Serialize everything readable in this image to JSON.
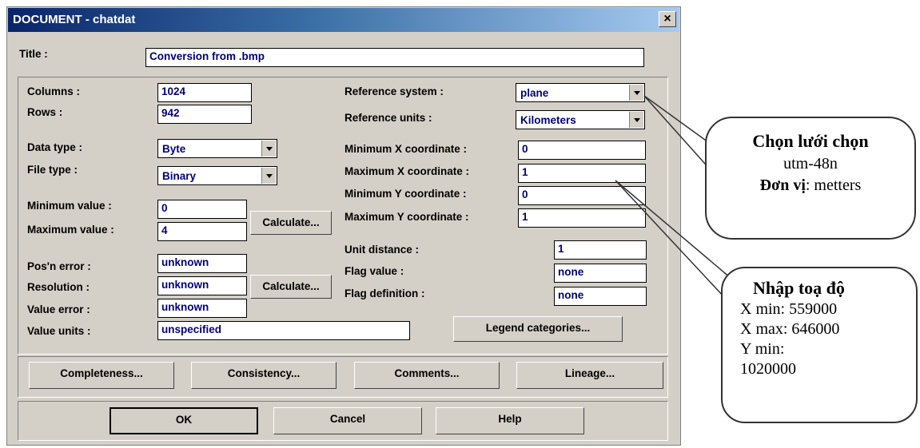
{
  "window": {
    "title": "DOCUMENT - chatdat",
    "close_glyph": "×"
  },
  "title_label": "Title :",
  "title_value": "Conversion from .bmp",
  "left": {
    "columns_label": "Columns :",
    "columns_value": "1024",
    "rows_label": "Rows :",
    "rows_value": "942",
    "data_type_label": "Data type :",
    "data_type_value": "Byte",
    "file_type_label": "File type :",
    "file_type_value": "Binary",
    "min_value_label": "Minimum value :",
    "min_value": "0",
    "max_value_label": "Maximum value :",
    "max_value": "4",
    "calculate1": "Calculate...",
    "pos_error_label": "Pos'n error :",
    "pos_error_value": "unknown",
    "resolution_label": "Resolution :",
    "resolution_value": "unknown",
    "calculate2": "Calculate...",
    "value_error_label": "Value error :",
    "value_error_value": "unknown",
    "value_units_label": "Value units :",
    "value_units_value": "unspecified"
  },
  "right": {
    "ref_system_label": "Reference system :",
    "ref_system_value": "plane",
    "ref_units_label": "Reference units :",
    "ref_units_value": "Kilometers",
    "min_x_label": "Minimum X coordinate :",
    "min_x_value": "0",
    "max_x_label": "Maximum X coordinate :",
    "max_x_value": "1",
    "min_y_label": "Minimum Y coordinate :",
    "min_y_value": "0",
    "max_y_label": "Maximum Y coordinate :",
    "max_y_value": "1",
    "unit_distance_label": "Unit distance :",
    "unit_distance_value": "1",
    "flag_value_label": "Flag value :",
    "flag_value_value": "none",
    "flag_def_label": "Flag definition :",
    "flag_def_value": "none",
    "legend_button": "Legend categories..."
  },
  "metadata_buttons": [
    "Completeness...",
    "Consistency...",
    "Comments...",
    "Lineage..."
  ],
  "dialog_buttons": {
    "ok": "OK",
    "cancel": "Cancel",
    "help": "Help"
  },
  "callout1": {
    "line1": "Chọn lưới chọn",
    "line2": "utm-48n",
    "line3_bold": "Đơn vị",
    "line3_rest": ": metters"
  },
  "callout2": {
    "title": "Nhập toạ độ",
    "line1": "X min: 559000",
    "line2": "X max: 646000",
    "line3": "Y min:",
    "line4": "1020000"
  }
}
